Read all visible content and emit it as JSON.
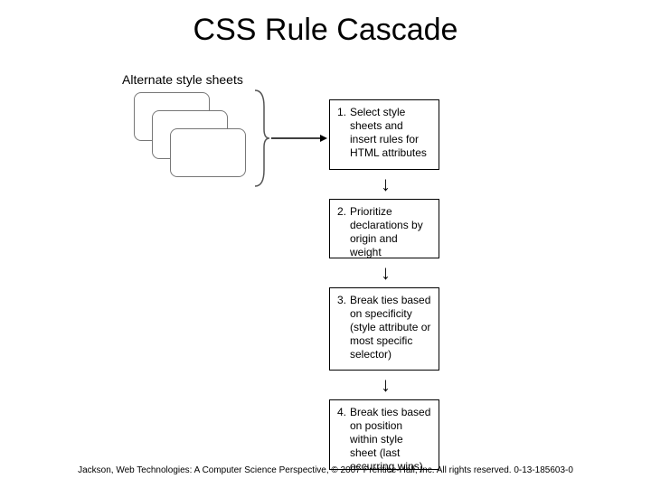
{
  "title": "CSS Rule Cascade",
  "altLabel": "Alternate style sheets",
  "steps": [
    {
      "num": "1.",
      "text": "Select style sheets and insert rules for HTML attributes"
    },
    {
      "num": "2.",
      "text": "Prioritize declarations by origin and weight"
    },
    {
      "num": "3.",
      "text": "Break ties based on specificity (style attribute or most specific selector)"
    },
    {
      "num": "4.",
      "text": "Break ties based on position within style sheet (last occurring wins)"
    }
  ],
  "footer": "Jackson, Web Technologies: A Computer Science Perspective, © 2007 Prentice-Hall, Inc. All rights reserved. 0-13-185603-0"
}
